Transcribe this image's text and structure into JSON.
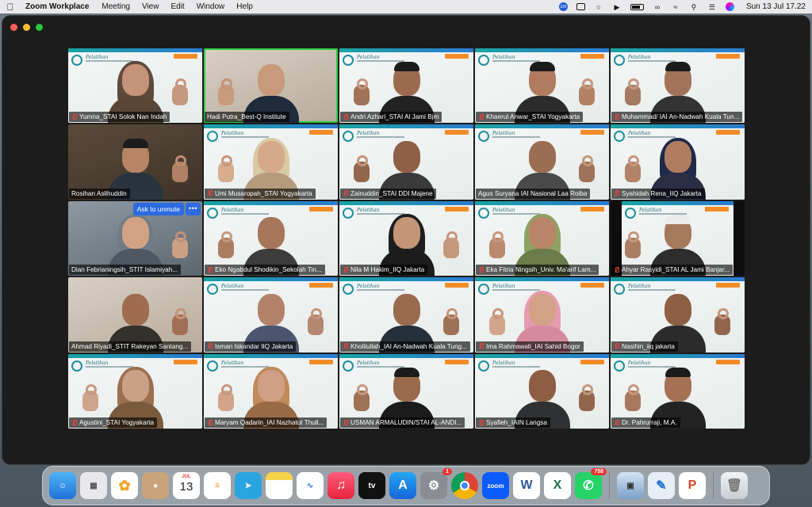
{
  "menubar": {
    "app_name": "Zoom Workplace",
    "items": [
      "Meeting",
      "View",
      "Edit",
      "Window",
      "Help"
    ],
    "zoom_status": "zm",
    "datetime": "Sun 13 Jul  17.22"
  },
  "meeting": {
    "ask_to_unmute": "Ask to unmute",
    "more": "•••",
    "banner_title": "Pelatihan"
  },
  "participants": [
    {
      "name": "Yumna_STAI Solok Nan Indah",
      "muted": true
    },
    {
      "name": "Hadi Putra_Best-Q Institute",
      "muted": false
    },
    {
      "name": "Andri Azhari_STAI Al Jami Bjm",
      "muted": true
    },
    {
      "name": "Khaerul Anwar_STAI Yogyakarta",
      "muted": true
    },
    {
      "name": "Muhammad/ IAI An-Nadwah Kuala Tun...",
      "muted": true
    },
    {
      "name": "Rosihan Aslihuddin",
      "muted": false
    },
    {
      "name": "Umi Musaropah_STAI Yogyakarta",
      "muted": true
    },
    {
      "name": "Zainuddin_STAI DDI Majene",
      "muted": true
    },
    {
      "name": "Agus Suryana IAI Nasional Laa Roiba",
      "muted": false
    },
    {
      "name": "Syahidah Rena_IIQ Jakarta",
      "muted": true
    },
    {
      "name": "Dian Febrianingsih_STIT Islamiyah...",
      "muted": false
    },
    {
      "name": "Eko Ngabdul Shodikin_Sekolah Tin...",
      "muted": true
    },
    {
      "name": "Nila M Hakim_IIQ Jakarta",
      "muted": true
    },
    {
      "name": "Eka Fitria Ningsih_Univ. Ma'arif Lam...",
      "muted": true
    },
    {
      "name": "Ahyar Rasyidi_STAI AL Jami Banjar...",
      "muted": true
    },
    {
      "name": "Ahmad Riyadi_STIT Rakeyan Santang...",
      "muted": false
    },
    {
      "name": "Isman Iskandar IIQ Jakarta",
      "muted": true
    },
    {
      "name": "Kholilullah_IAI An-Nadwah Kuala Tung...",
      "muted": true
    },
    {
      "name": "Ima Rahmawati_IAI Sahid Bogor",
      "muted": true
    },
    {
      "name": "Nasihin_iiq jakarta",
      "muted": true
    },
    {
      "name": "Agustini_STAI Yogyakarta",
      "muted": true
    },
    {
      "name": "Maryam Qadarin_IAI Nazhatut Thull...",
      "muted": true
    },
    {
      "name": "USMAN ARMALUDIN/STAI AL-ANDI...",
      "muted": true
    },
    {
      "name": "Syafieh_IAIN Langsa",
      "muted": true
    },
    {
      "name": "Dr. Pahrurraji, M.A.",
      "muted": true
    }
  ],
  "dock": {
    "calendar_month": "JUL",
    "calendar_day": "13",
    "settings_badge": "1",
    "whatsapp_badge": "758",
    "zoom_label": "zoom",
    "tv_label": "tv",
    "apps": [
      "Finder",
      "Launchpad",
      "Photos",
      "Contacts",
      "Calendar",
      "Reminders",
      "Telegram",
      "Notes",
      "Freeform",
      "Music",
      "Apple TV",
      "App Store",
      "System Settings",
      "Chrome",
      "Zoom",
      "Word",
      "Excel",
      "WhatsApp",
      "Preview",
      "Pencil",
      "PowerPoint",
      "Trash"
    ]
  }
}
